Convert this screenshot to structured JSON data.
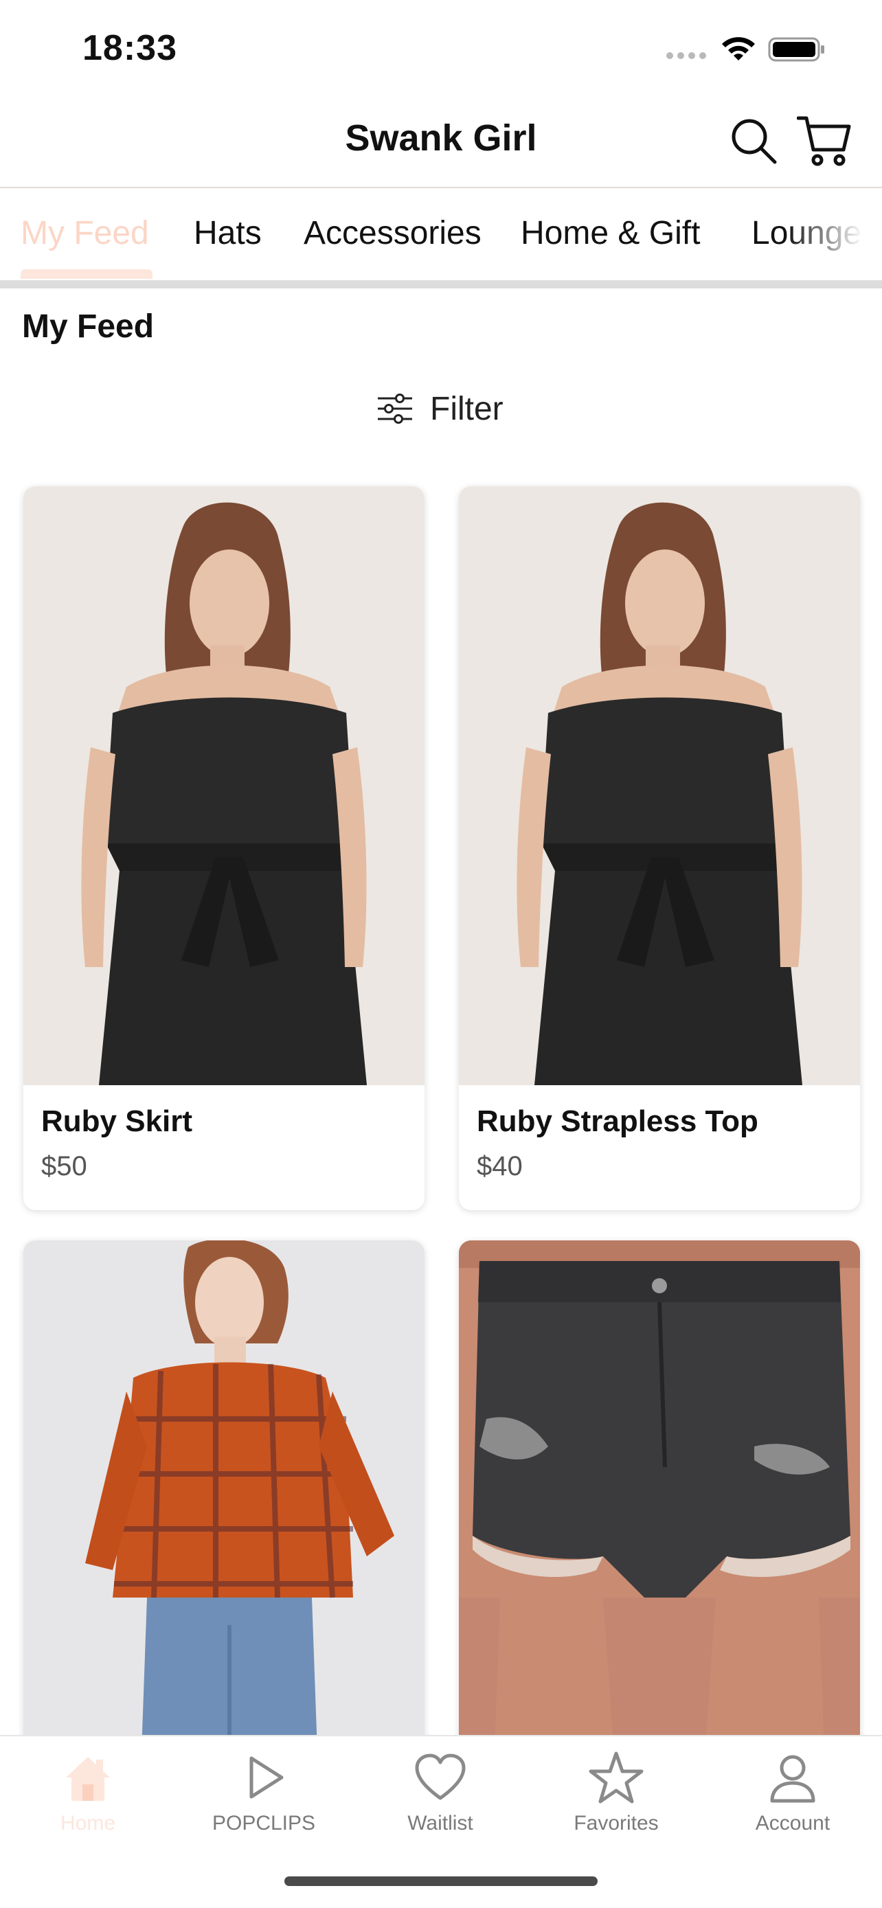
{
  "status": {
    "time": "18:33"
  },
  "header": {
    "title": "Swank Girl"
  },
  "tabs": [
    {
      "label": "My Feed",
      "active": true
    },
    {
      "label": "Hats"
    },
    {
      "label": "Accessories"
    },
    {
      "label": "Home & Gift"
    },
    {
      "label": "Lounge"
    }
  ],
  "feed": {
    "title": "My Feed",
    "filter_label": "Filter"
  },
  "products": [
    {
      "name": "Ruby Skirt",
      "price": "$50"
    },
    {
      "name": "Ruby Strapless Top",
      "price": "$40"
    },
    {
      "name": "",
      "price": ""
    },
    {
      "name": "",
      "price": ""
    }
  ],
  "tab_bar": {
    "items": [
      {
        "label": "Home",
        "icon": "home-icon",
        "active": true
      },
      {
        "label": "POPCLIPS",
        "icon": "play-icon"
      },
      {
        "label": "Waitlist",
        "icon": "heart-icon"
      },
      {
        "label": "Favorites",
        "icon": "star-icon"
      },
      {
        "label": "Account",
        "icon": "person-icon"
      }
    ]
  },
  "colors": {
    "accent": "#fde6dc",
    "accent_text": "#fbd6c6"
  }
}
